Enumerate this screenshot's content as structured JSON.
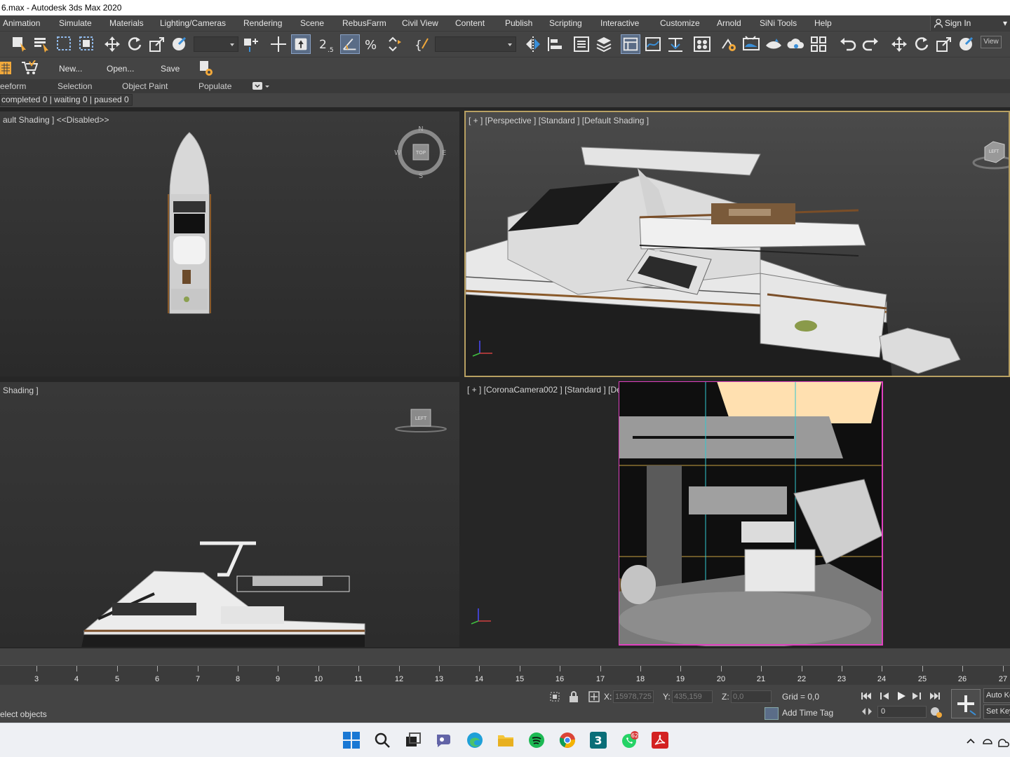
{
  "window": {
    "title": "6.max - Autodesk 3ds Max 2020"
  },
  "menu": {
    "items": [
      "Animation",
      "Simulate",
      "Materials",
      "Lighting/Cameras",
      "Rendering",
      "Scene",
      "RebusFarm",
      "Civil View",
      "Content",
      "Publish",
      "Scripting",
      "Interactive",
      "Customize",
      "Arnold",
      "SiNi Tools",
      "Help"
    ],
    "sign_in": "Sign In"
  },
  "toolbar": {
    "view_label": "View"
  },
  "ribbon": {
    "new_label": "New...",
    "open_label": "Open...",
    "save_label": "Save"
  },
  "ribbon_tabs": [
    "eeform",
    "Selection",
    "Object Paint",
    "Populate"
  ],
  "render_status": "completed 0 | waiting 0 | paused 0",
  "viewports": {
    "top": {
      "label": "ault Shading ]  <<Disabled>>",
      "cube_label": "TOP",
      "compass": [
        "N",
        "E",
        "S",
        "W"
      ]
    },
    "perspective": {
      "label": "[ + ] [Perspective ] [Standard ] [Default Shading ]",
      "cube_label": "LEFT"
    },
    "left": {
      "label": "Shading ]",
      "cube_label": "LEFT"
    },
    "camera": {
      "label": "[ + ] [CoronaCamera002 ] [Standard ] [Default Shading ]"
    }
  },
  "timeline": {
    "ticks": [
      "3",
      "4",
      "5",
      "6",
      "7",
      "8",
      "9",
      "10",
      "11",
      "12",
      "13",
      "14",
      "15",
      "16",
      "17",
      "18",
      "19",
      "20",
      "21",
      "22",
      "23",
      "24",
      "25",
      "26",
      "27"
    ]
  },
  "status": {
    "prompt": "elect objects",
    "x_label": "X:",
    "x_value": "15978,725",
    "y_label": "Y:",
    "y_value": "435,159",
    "z_label": "Z:",
    "z_value": "0,0",
    "grid": "Grid = 0,0",
    "add_time_tag": "Add Time Tag",
    "frame": "0",
    "auto_key": "Auto Key",
    "set_key": "Set Key"
  },
  "taskbar": {
    "whatsapp_badge": "62"
  },
  "colors": {
    "active_border": "#b8a062",
    "safe_frame": "#e040c0",
    "toolbar_active": "#5a6c86"
  }
}
